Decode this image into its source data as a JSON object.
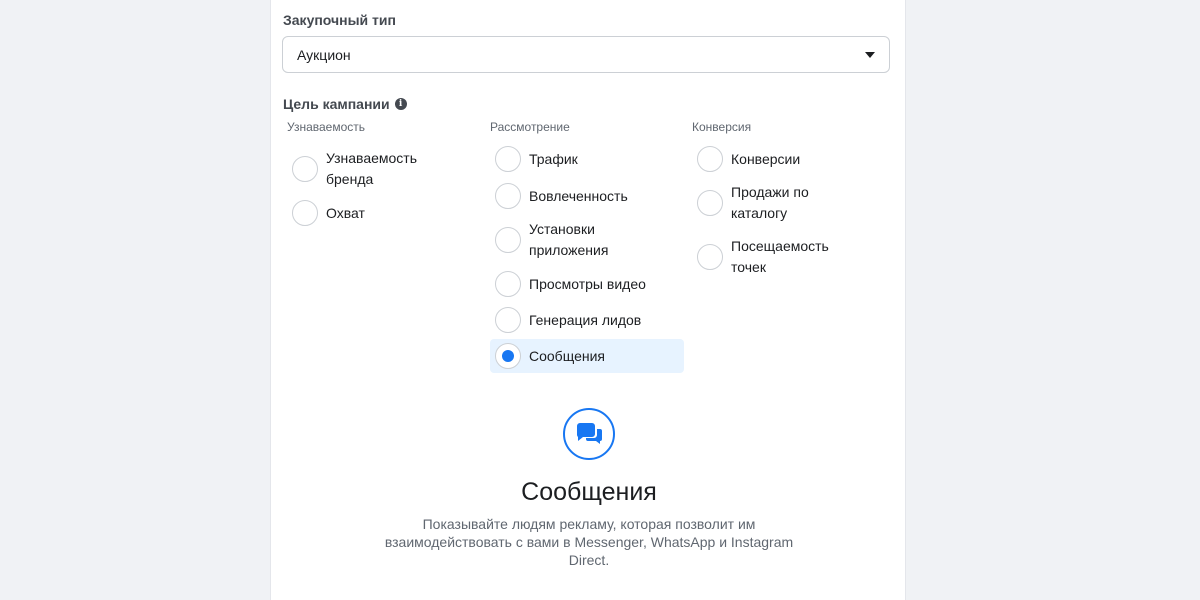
{
  "buying_type": {
    "label": "Закупочный тип",
    "selected": "Аукцион"
  },
  "campaign_objective": {
    "label": "Цель кампании",
    "info_icon": "i",
    "columns": [
      {
        "header": "Узнаваемость",
        "options": [
          {
            "label": "Узнаваемость бренда",
            "selected": false
          },
          {
            "label": "Охват",
            "selected": false
          }
        ]
      },
      {
        "header": "Рассмотрение",
        "options": [
          {
            "label": "Трафик",
            "selected": false
          },
          {
            "label": "Вовлеченность",
            "selected": false
          },
          {
            "label": "Установки приложения",
            "selected": false
          },
          {
            "label": "Просмотры видео",
            "selected": false
          },
          {
            "label": "Генерация лидов",
            "selected": false
          },
          {
            "label": "Сообщения",
            "selected": true
          }
        ]
      },
      {
        "header": "Конверсия",
        "options": [
          {
            "label": "Конверсии",
            "selected": false
          },
          {
            "label": "Продажи по каталогу",
            "selected": false
          },
          {
            "label": "Посещаемость точек",
            "selected": false
          }
        ]
      }
    ]
  },
  "detail": {
    "icon": "messages-icon",
    "title": "Сообщения",
    "description": "Показывайте людям рекламу, которая позволит им взаимодействовать с вами в Messenger, WhatsApp и Instagram Direct."
  },
  "colors": {
    "accent": "#1877f2",
    "selected_bg": "#e7f3ff",
    "page_bg": "#f0f2f5"
  }
}
